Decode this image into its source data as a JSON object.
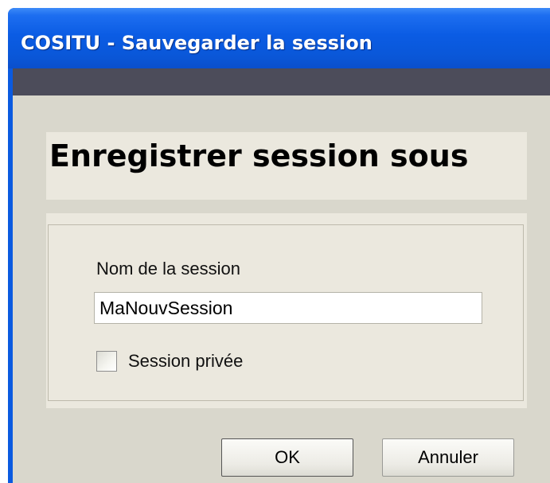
{
  "window": {
    "title": "COSITU - Sauvegarder la session"
  },
  "header": {
    "title": "Enregistrer session sous"
  },
  "form": {
    "session_name_label": "Nom de la session",
    "session_name_value": "MaNouvSession",
    "private_label": "Session privée",
    "private_checked": false
  },
  "buttons": {
    "ok_label": "OK",
    "cancel_label": "Annuler"
  },
  "colors": {
    "titlebar": "#0a5ae0",
    "dialog_background": "#d9d7cc",
    "panel_background": "#ebe8de"
  }
}
